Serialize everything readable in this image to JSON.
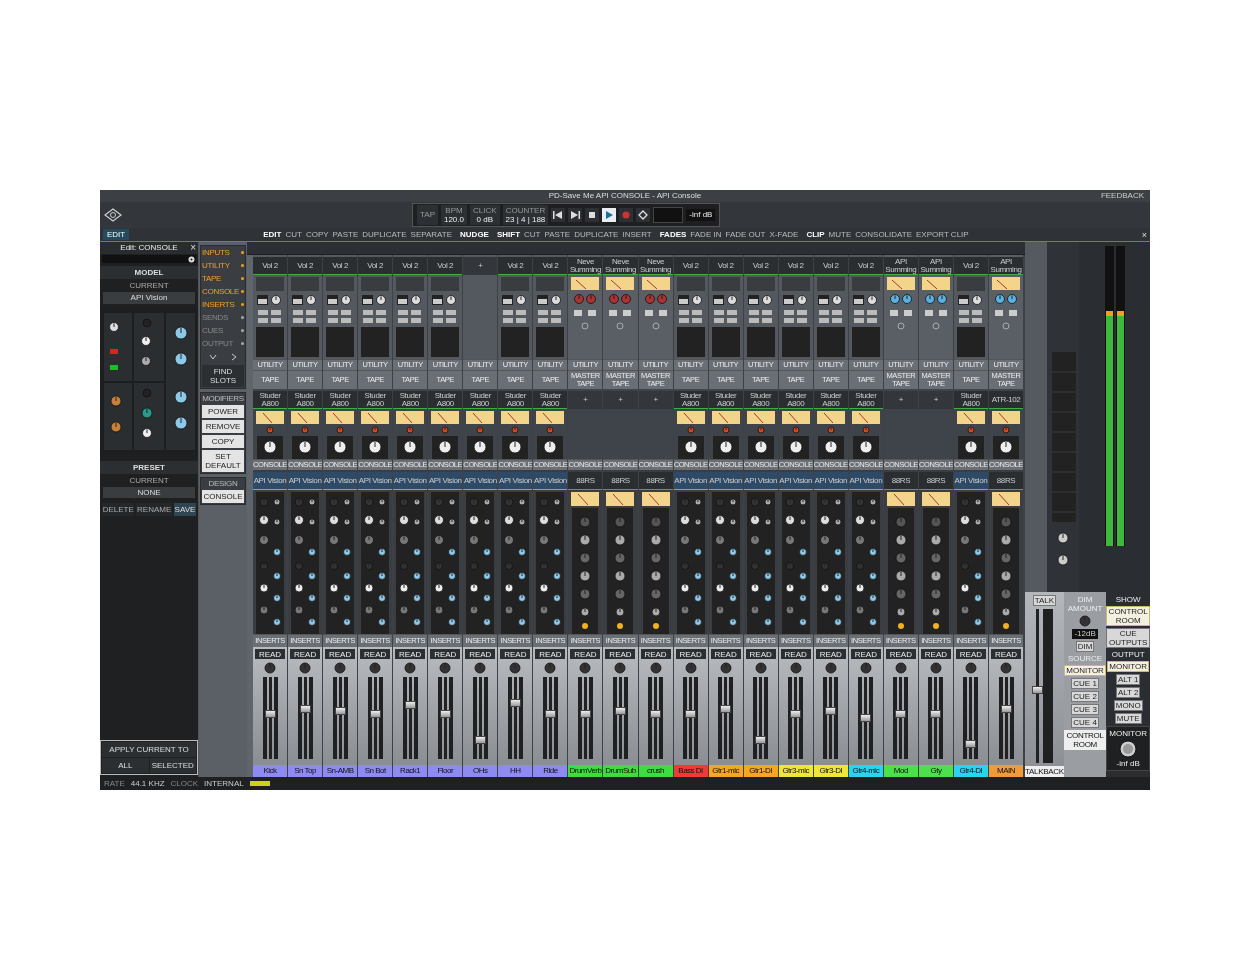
{
  "window": {
    "title": "PD-Save Me API CONSOLE - API Console",
    "feedback": "FEEDBACK"
  },
  "transport": {
    "fields": [
      {
        "label": "TAP"
      },
      {
        "label": "BPM",
        "value": "120.0"
      },
      {
        "label": "CLICK",
        "value": "0 dB"
      },
      {
        "label": "COUNTER",
        "value": "23 | 4 | 188"
      }
    ],
    "buttons": [
      {
        "kind": "rewind",
        "selected": false
      },
      {
        "kind": "forward",
        "selected": false
      },
      {
        "kind": "stop",
        "selected": false
      },
      {
        "kind": "play",
        "selected": true
      },
      {
        "kind": "record",
        "selected": false
      },
      {
        "kind": "loop",
        "selected": false
      }
    ],
    "monitor": "-inf dB"
  },
  "edit_tab": "EDIT",
  "edit_bar": [
    {
      "kind": "group",
      "text": "EDIT"
    },
    {
      "kind": "button",
      "text": "CUT"
    },
    {
      "kind": "button",
      "text": "COPY"
    },
    {
      "kind": "button",
      "text": "PASTE"
    },
    {
      "kind": "button",
      "text": "DUPLICATE"
    },
    {
      "kind": "button",
      "text": "SEPARATE"
    },
    {
      "kind": "group",
      "text": "NUDGE"
    },
    {
      "kind": "group",
      "text": "SHIFT"
    },
    {
      "kind": "button",
      "text": "CUT"
    },
    {
      "kind": "button",
      "text": "PASTE"
    },
    {
      "kind": "button",
      "text": "DUPLICATE"
    },
    {
      "kind": "button",
      "text": "INSERT"
    },
    {
      "kind": "group",
      "text": "FADES"
    },
    {
      "kind": "button",
      "text": "FADE IN"
    },
    {
      "kind": "button",
      "text": "FADE OUT"
    },
    {
      "kind": "button",
      "text": "X-FADE"
    },
    {
      "kind": "group",
      "text": "CLIP"
    },
    {
      "kind": "button",
      "text": "MUTE"
    },
    {
      "kind": "button",
      "text": "CONSOLIDATE"
    },
    {
      "kind": "button",
      "text": "EXPORT CLIP"
    }
  ],
  "edit_bar_close": "×",
  "edit_panel": {
    "title": "Edit: CONSOLE",
    "close": "×",
    "model_heading": "MODEL",
    "model_current": "CURRENT",
    "model_value": "API Vision",
    "preset_heading": "PRESET",
    "preset_current": "CURRENT",
    "preset_value": "NONE",
    "preset_buttons": [
      {
        "text": "DELETE",
        "selected": false
      },
      {
        "text": "RENAME",
        "selected": false
      },
      {
        "text": "SAVE",
        "selected": true
      }
    ],
    "apply_heading": "APPLY CURRENT TO",
    "apply_buttons": [
      "ALL",
      "SELECTED"
    ]
  },
  "sections": [
    {
      "label": "INPUTS",
      "on": true
    },
    {
      "label": "UTILITY",
      "on": true
    },
    {
      "label": "TAPE",
      "on": true
    },
    {
      "label": "CONSOLE",
      "on": true
    },
    {
      "label": "INSERTS",
      "on": true
    },
    {
      "label": "SENDS",
      "on": false
    },
    {
      "label": "CUES",
      "on": false
    },
    {
      "label": "OUTPUT",
      "on": false
    }
  ],
  "section_tools": [
    "FIND SLOTS"
  ],
  "modifiers_heading": "MODIFIERS",
  "modifiers": [
    "POWER",
    "REMOVE",
    "COPY",
    "SET DEFAULT"
  ],
  "design_heading": "DESIGN",
  "design_button": "CONSOLE",
  "channels": [
    {
      "name": "Kick",
      "color": "#8d8af2",
      "utility": {
        "kind": "vol",
        "label": "Vol 2"
      },
      "utility_row": "UTILITY",
      "tape_row": "TAPE",
      "tape": {
        "kind": "studer",
        "label": "Studer A800"
      },
      "console_row": "CONSOLE",
      "console": {
        "kind": "api",
        "label": "API Vision"
      },
      "inserts_row": "INSERTS",
      "automation": "READ",
      "fader": {
        "level": 0.55
      }
    },
    {
      "name": "Sn Top",
      "color": "#8d8af2",
      "utility": {
        "kind": "vol",
        "label": "Vol 2"
      },
      "utility_row": "UTILITY",
      "tape_row": "TAPE",
      "tape": {
        "kind": "studer",
        "label": "Studer A800"
      },
      "console_row": "CONSOLE",
      "console": {
        "kind": "api",
        "label": "API Vision"
      },
      "inserts_row": "INSERTS",
      "automation": "READ",
      "fader": {
        "level": 0.62
      }
    },
    {
      "name": "Sn-AMB",
      "color": "#8d8af2",
      "utility": {
        "kind": "vol",
        "label": "Vol 2"
      },
      "utility_row": "UTILITY",
      "tape_row": "TAPE",
      "tape": {
        "kind": "studer",
        "label": "Studer A800"
      },
      "console_row": "CONSOLE",
      "console": {
        "kind": "api",
        "label": "API Vision"
      },
      "inserts_row": "INSERTS",
      "automation": "READ",
      "fader": {
        "level": 0.6
      }
    },
    {
      "name": "Sn Bot",
      "color": "#8d8af2",
      "utility": {
        "kind": "vol",
        "label": "Vol 2"
      },
      "utility_row": "UTILITY",
      "tape_row": "TAPE",
      "tape": {
        "kind": "studer",
        "label": "Studer A800"
      },
      "console_row": "CONSOLE",
      "console": {
        "kind": "api",
        "label": "API Vision"
      },
      "inserts_row": "INSERTS",
      "automation": "READ",
      "fader": {
        "level": 0.55
      }
    },
    {
      "name": "Rack1",
      "color": "#8d8af2",
      "utility": {
        "kind": "vol",
        "label": "Vol 2"
      },
      "utility_row": "UTILITY",
      "tape_row": "TAPE",
      "tape": {
        "kind": "studer",
        "label": "Studer A800"
      },
      "console_row": "CONSOLE",
      "console": {
        "kind": "api",
        "label": "API Vision"
      },
      "inserts_row": "INSERTS",
      "automation": "READ",
      "fader": {
        "level": 0.68
      }
    },
    {
      "name": "Floor",
      "color": "#8d8af2",
      "utility": {
        "kind": "vol",
        "label": "Vol 2"
      },
      "utility_row": "UTILITY",
      "tape_row": "TAPE",
      "tape": {
        "kind": "studer",
        "label": "Studer A800"
      },
      "console_row": "CONSOLE",
      "console": {
        "kind": "api",
        "label": "API Vision"
      },
      "inserts_row": "INSERTS",
      "automation": "READ",
      "fader": {
        "level": 0.55
      }
    },
    {
      "name": "OHs",
      "color": "#8d8af2",
      "utility": {
        "kind": "empty",
        "label": "+"
      },
      "utility_row": "UTILITY",
      "tape_row": "TAPE",
      "tape": {
        "kind": "studer",
        "label": "Studer A800"
      },
      "console_row": "CONSOLE",
      "console": {
        "kind": "api",
        "label": "API Vision"
      },
      "inserts_row": "INSERTS",
      "automation": "READ",
      "fader": {
        "level": 0.2
      }
    },
    {
      "name": "HH",
      "color": "#8d8af2",
      "utility": {
        "kind": "vol",
        "label": "Vol 2"
      },
      "utility_row": "UTILITY",
      "tape_row": "TAPE",
      "tape": {
        "kind": "studer",
        "label": "Studer A800"
      },
      "console_row": "CONSOLE",
      "console": {
        "kind": "api",
        "label": "API Vision"
      },
      "inserts_row": "INSERTS",
      "automation": "READ",
      "fader": {
        "level": 0.7
      }
    },
    {
      "name": "Ride",
      "color": "#8d8af2",
      "utility": {
        "kind": "vol",
        "label": "Vol 2"
      },
      "utility_row": "UTILITY",
      "tape_row": "TAPE",
      "tape": {
        "kind": "studer",
        "label": "Studer A800"
      },
      "console_row": "CONSOLE",
      "console": {
        "kind": "api",
        "label": "API Vision"
      },
      "inserts_row": "INSERTS",
      "automation": "READ",
      "fader": {
        "level": 0.55
      }
    },
    {
      "name": "DrumVerb",
      "color": "#3fdc3f",
      "utility": {
        "kind": "summing",
        "label": "Neve Summing"
      },
      "utility_row": "UTILITY",
      "tape_row": "MASTER TAPE",
      "tape": {
        "kind": "empty",
        "label": "+"
      },
      "console_row": "CONSOLE",
      "console": {
        "kind": "neve",
        "label": "88RS"
      },
      "inserts_row": "INSERTS",
      "automation": "READ",
      "fader": {
        "level": 0.55
      }
    },
    {
      "name": "DrumSub",
      "color": "#3fdc3f",
      "utility": {
        "kind": "summing",
        "label": "Neve Summing"
      },
      "utility_row": "UTILITY",
      "tape_row": "MASTER TAPE",
      "tape": {
        "kind": "empty",
        "label": "+"
      },
      "console_row": "CONSOLE",
      "console": {
        "kind": "neve",
        "label": "88RS"
      },
      "inserts_row": "INSERTS",
      "automation": "READ",
      "fader": {
        "level": 0.6
      }
    },
    {
      "name": "crush",
      "color": "#3fdc3f",
      "utility": {
        "kind": "summing",
        "label": "Neve Summing"
      },
      "utility_row": "UTILITY",
      "tape_row": "MASTER TAPE",
      "tape": {
        "kind": "empty",
        "label": "+"
      },
      "console_row": "CONSOLE",
      "console": {
        "kind": "neve",
        "label": "88RS"
      },
      "inserts_row": "INSERTS",
      "automation": "READ",
      "fader": {
        "level": 0.55
      }
    },
    {
      "name": "Bass DI",
      "color": "#f03a3a",
      "utility": {
        "kind": "vol",
        "label": "Vol 2"
      },
      "utility_row": "UTILITY",
      "tape_row": "TAPE",
      "tape": {
        "kind": "studer",
        "label": "Studer A800"
      },
      "console_row": "CONSOLE",
      "console": {
        "kind": "api",
        "label": "API Vision"
      },
      "inserts_row": "INSERTS",
      "automation": "READ",
      "fader": {
        "level": 0.55
      }
    },
    {
      "name": "Gtr1-mic",
      "color": "#f5a623",
      "utility": {
        "kind": "vol",
        "label": "Vol 2"
      },
      "utility_row": "UTILITY",
      "tape_row": "TAPE",
      "tape": {
        "kind": "studer",
        "label": "Studer A800"
      },
      "console_row": "CONSOLE",
      "console": {
        "kind": "api",
        "label": "API Vision"
      },
      "inserts_row": "INSERTS",
      "automation": "READ",
      "fader": {
        "level": 0.62
      }
    },
    {
      "name": "Gtr1-DI",
      "color": "#f5a623",
      "utility": {
        "kind": "vol",
        "label": "Vol 2"
      },
      "utility_row": "UTILITY",
      "tape_row": "TAPE",
      "tape": {
        "kind": "studer",
        "label": "Studer A800"
      },
      "console_row": "CONSOLE",
      "console": {
        "kind": "api",
        "label": "API Vision"
      },
      "inserts_row": "INSERTS",
      "automation": "READ",
      "fader": {
        "level": 0.2
      }
    },
    {
      "name": "Gtr3-mic",
      "color": "#f0e63a",
      "utility": {
        "kind": "vol",
        "label": "Vol 2"
      },
      "utility_row": "UTILITY",
      "tape_row": "TAPE",
      "tape": {
        "kind": "studer",
        "label": "Studer A800"
      },
      "console_row": "CONSOLE",
      "console": {
        "kind": "api",
        "label": "API Vision"
      },
      "inserts_row": "INSERTS",
      "automation": "READ",
      "fader": {
        "level": 0.55
      }
    },
    {
      "name": "Gtr3-DI",
      "color": "#f0e63a",
      "utility": {
        "kind": "vol",
        "label": "Vol 2"
      },
      "utility_row": "UTILITY",
      "tape_row": "TAPE",
      "tape": {
        "kind": "studer",
        "label": "Studer A800"
      },
      "console_row": "CONSOLE",
      "console": {
        "kind": "api",
        "label": "API Vision"
      },
      "inserts_row": "INSERTS",
      "automation": "READ",
      "fader": {
        "level": 0.6
      }
    },
    {
      "name": "Gtr4-mic",
      "color": "#2ad4f0",
      "utility": {
        "kind": "vol",
        "label": "Vol 2"
      },
      "utility_row": "UTILITY",
      "tape_row": "TAPE",
      "tape": {
        "kind": "studer",
        "label": "Studer A800"
      },
      "console_row": "CONSOLE",
      "console": {
        "kind": "api",
        "label": "API Vision"
      },
      "inserts_row": "INSERTS",
      "automation": "READ",
      "fader": {
        "level": 0.5
      }
    },
    {
      "name": "Mod",
      "color": "#4ce04c",
      "utility": {
        "kind": "summing",
        "label": "API Summing"
      },
      "utility_row": "UTILITY",
      "tape_row": "MASTER TAPE",
      "tape": {
        "kind": "empty",
        "label": "+"
      },
      "console_row": "CONSOLE",
      "console": {
        "kind": "neve",
        "label": "88RS"
      },
      "inserts_row": "INSERTS",
      "automation": "READ",
      "fader": {
        "level": 0.55
      }
    },
    {
      "name": "Gty",
      "color": "#4ce04c",
      "utility": {
        "kind": "summing",
        "label": "API Summing"
      },
      "utility_row": "UTILITY",
      "tape_row": "MASTER TAPE",
      "tape": {
        "kind": "empty",
        "label": "+"
      },
      "console_row": "CONSOLE",
      "console": {
        "kind": "neve",
        "label": "88RS"
      },
      "inserts_row": "INSERTS",
      "automation": "READ",
      "fader": {
        "level": 0.55
      }
    },
    {
      "name": "Gtr4-DI",
      "color": "#2ad4f0",
      "utility": {
        "kind": "vol",
        "label": "Vol 2"
      },
      "utility_row": "UTILITY",
      "tape_row": "TAPE",
      "tape": {
        "kind": "studer",
        "label": "Studer A800"
      },
      "console_row": "CONSOLE",
      "console": {
        "kind": "api",
        "label": "API Vision"
      },
      "inserts_row": "INSERTS",
      "automation": "READ",
      "fader": {
        "level": 0.15
      }
    },
    {
      "name": "MAIN",
      "color": "#f09a3a",
      "utility": {
        "kind": "summing",
        "label": "API Summing"
      },
      "utility_row": "UTILITY",
      "tape_row": "MASTER TAPE",
      "tape": {
        "kind": "studer",
        "label": "ATR-102"
      },
      "console_row": "CONSOLE",
      "console": {
        "kind": "neve",
        "label": "88RS"
      },
      "inserts_row": "INSERTS",
      "automation": "READ",
      "fader": {
        "level": 0.62
      }
    }
  ],
  "talkback": {
    "talk": "TALK",
    "label": "TALKBACK"
  },
  "control_room": {
    "dim_amount": "DIM AMOUNT",
    "dim_value": "-12dB",
    "dim": "DIM",
    "source": "SOURCE",
    "monitor": "MONITOR",
    "cues": [
      "CUE 1",
      "CUE 2",
      "CUE 3",
      "CUE 4"
    ],
    "label": "CONTROL ROOM"
  },
  "show": {
    "heading": "SHOW",
    "buttons": [
      {
        "text": "CONTROL ROOM",
        "selected": true
      },
      {
        "text": "CUE OUTPUTS",
        "selected": false
      }
    ]
  },
  "output": {
    "heading": "OUTPUT",
    "monitor": "MONITOR",
    "buttons": [
      "ALT 1",
      "ALT 2",
      "MONO",
      "MUTE"
    ],
    "knob_label": "MONITOR",
    "knob_value": "-inf dB"
  },
  "status_bar": {
    "rate_label": "RATE",
    "rate": "44.1 KHZ",
    "clock_label": "CLOCK",
    "clock": "INTERNAL"
  }
}
